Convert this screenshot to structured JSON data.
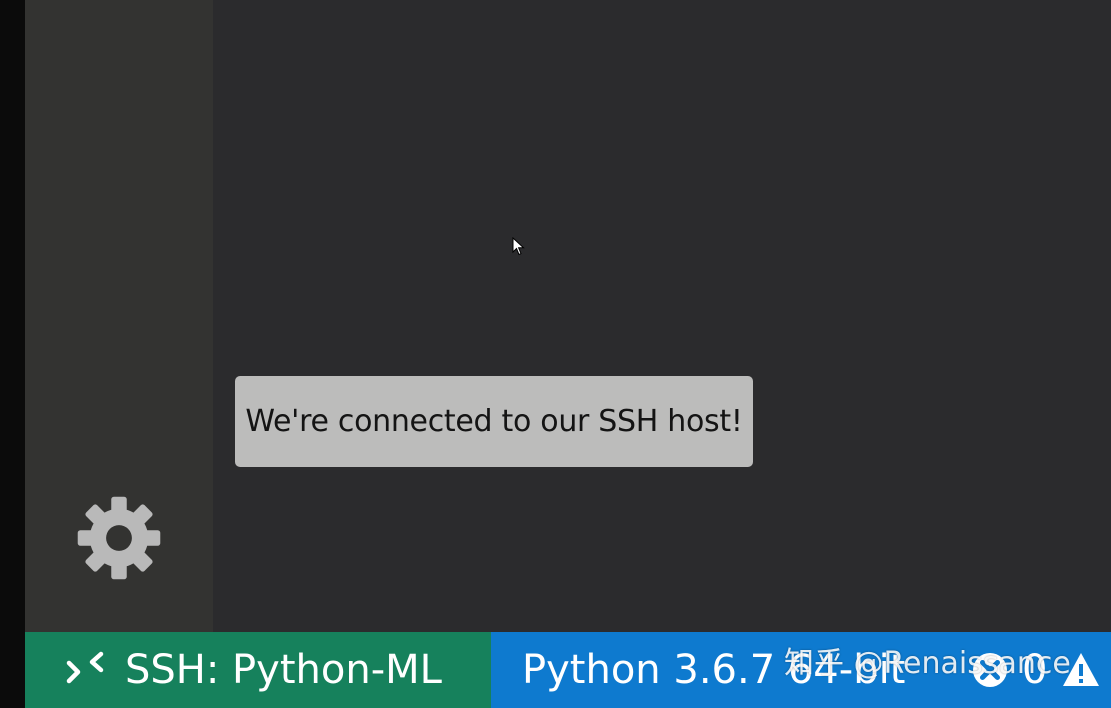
{
  "callout": {
    "text": "We're connected to our SSH host!"
  },
  "activity_bar": {
    "gear_icon": "gear-icon"
  },
  "status_bar": {
    "remote_label": "SSH: Python-ML",
    "remote_icon": "remote-icon",
    "python_label": "Python 3.6.7 64-bit",
    "errors_count": "0",
    "error_icon": "error-icon",
    "warning_icon": "warning-icon"
  },
  "watermark": {
    "text": "知乎 @Renaissance"
  },
  "colors": {
    "editor_bg": "#2b2b2d",
    "activity_bar_bg": "#333331",
    "status_bar_bg": "#0e7acf",
    "remote_bg": "#16815c",
    "callout_bg": "#bcbcbb"
  }
}
